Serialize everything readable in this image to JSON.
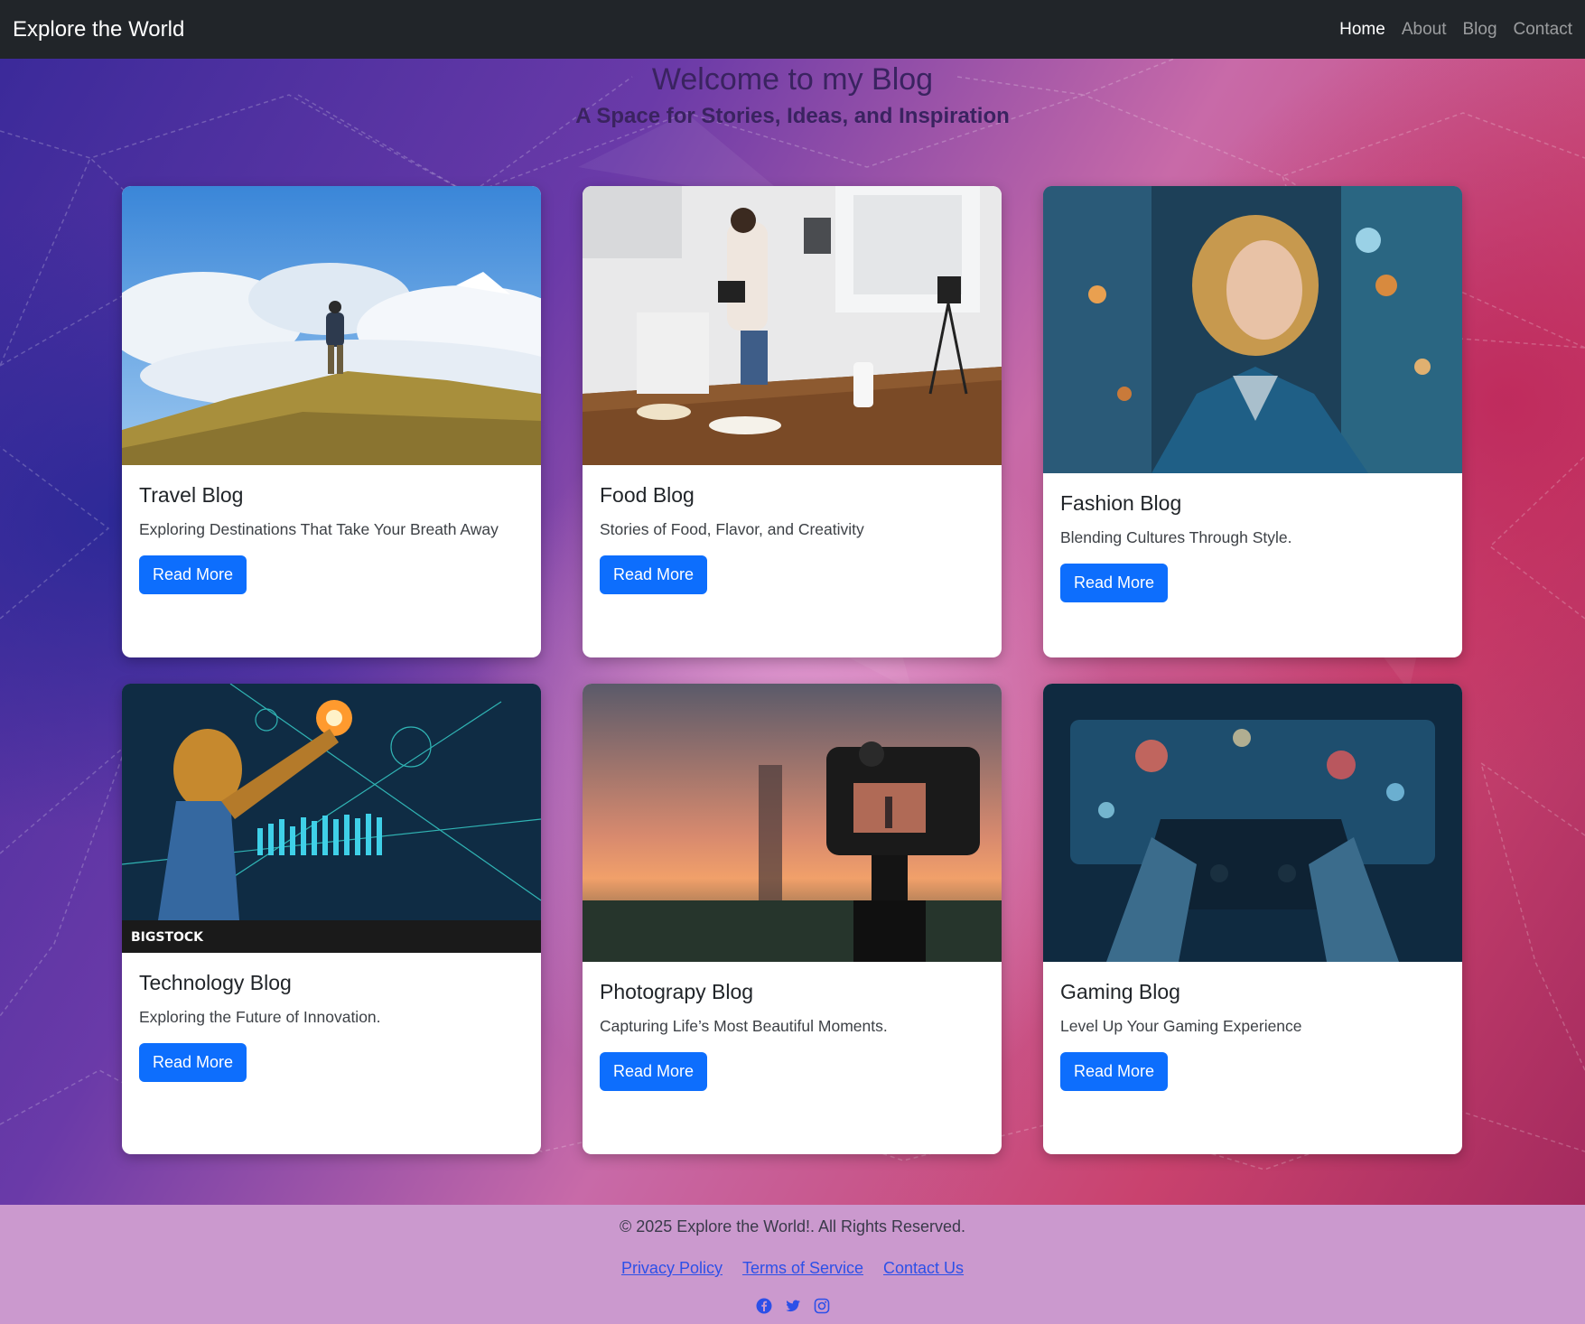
{
  "navbar": {
    "brand": "Explore the World",
    "links": [
      {
        "label": "Home",
        "active": true
      },
      {
        "label": "About",
        "active": false
      },
      {
        "label": "Blog",
        "active": false
      },
      {
        "label": "Contact",
        "active": false
      }
    ]
  },
  "hero": {
    "title": "Welcome to my Blog",
    "subtitle": "A Space for Stories, Ideas, and Inspiration"
  },
  "cards": [
    {
      "title": "Travel Blog",
      "text": "Exploring Destinations That Take Your Breath Away",
      "button": "Read More",
      "image": "hiker-on-mountain"
    },
    {
      "title": "Food Blog",
      "text": "Stories of Food, Flavor, and Creativity",
      "button": "Read More",
      "image": "woman-photographing-food"
    },
    {
      "title": "Fashion Blog",
      "text": "Blending Cultures Through Style.",
      "button": "Read More",
      "image": "woman-fashion-portrait"
    },
    {
      "title": "Technology Blog",
      "text": "Exploring the Future of Innovation.",
      "button": "Read More",
      "image": "robot-holographic-interface",
      "image_text": "BIGSTOCK"
    },
    {
      "title": "Photograpy Blog",
      "text": "Capturing Life’s Most Beautiful Moments.",
      "button": "Read More",
      "image": "camera-on-tripod-sunset"
    },
    {
      "title": "Gaming Blog",
      "text": "Level Up Your Gaming Experience",
      "button": "Read More",
      "image": "hands-holding-gamepad"
    }
  ],
  "footer": {
    "copyright": "© 2025 Explore the World!. All Rights Reserved.",
    "links": [
      "Privacy Policy",
      "Terms of Service",
      "Contact Us"
    ],
    "social": [
      "facebook-icon",
      "twitter-icon",
      "instagram-icon"
    ]
  },
  "colors": {
    "navbar": "#212529",
    "button": "#0d6efd",
    "footer": "#cb99ce",
    "link": "#2c50e8"
  }
}
